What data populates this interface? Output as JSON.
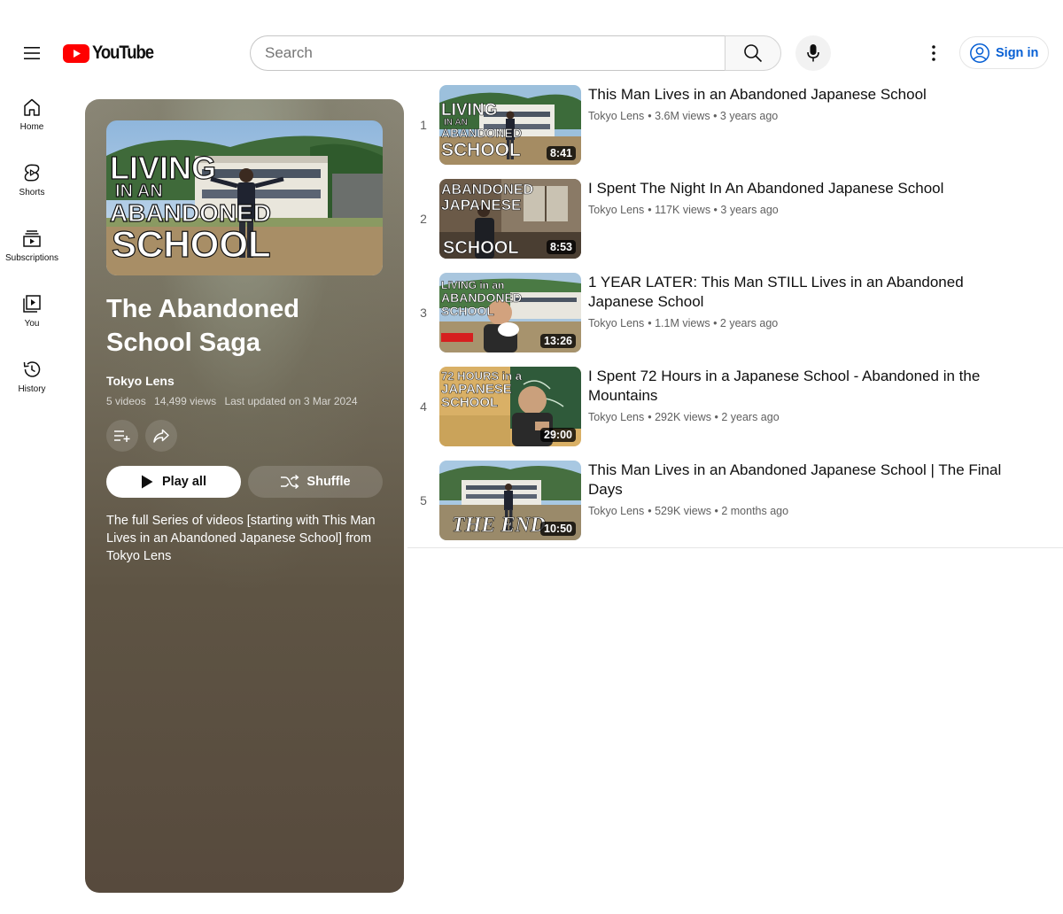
{
  "masthead": {
    "logo_text": "YouTube",
    "search_placeholder": "Search",
    "signin_label": "Sign in"
  },
  "guide": {
    "items": [
      {
        "label": "Home"
      },
      {
        "label": "Shorts"
      },
      {
        "label": "Subscriptions"
      },
      {
        "label": "You"
      },
      {
        "label": "History"
      }
    ]
  },
  "playlist": {
    "title": "The Abandoned School Saga",
    "owner": "Tokyo Lens",
    "video_count": "5 videos",
    "views": "14,499 views",
    "last_updated": "Last updated on 3 Mar 2024",
    "play_all_label": "Play all",
    "shuffle_label": "Shuffle",
    "description": "The full Series of videos [starting with This Man Lives in an Abandoned Japanese School] from Tokyo Lens",
    "thumbnail_text": [
      "LIVING",
      "IN AN",
      "ABANDONED",
      "SCHOOL"
    ]
  },
  "videos": [
    {
      "index": "1",
      "title": "This Man Lives in an Abandoned Japanese School",
      "channel": "Tokyo Lens",
      "stats": "• 3.6M views • 3 years ago",
      "duration": "8:41",
      "thumb_text": [
        "LIVING",
        "IN AN",
        "ABANDONED",
        "SCHOOL"
      ]
    },
    {
      "index": "2",
      "title": "I Spent The Night In An Abandoned Japanese School",
      "channel": "Tokyo Lens",
      "stats": "• 117K views • 3 years ago",
      "duration": "8:53",
      "thumb_text": [
        "ABANDONED",
        "JAPANESE",
        "SCHOOL"
      ]
    },
    {
      "index": "3",
      "title": "1 YEAR LATER: This Man STILL Lives in an Abandoned Japanese School",
      "channel": "Tokyo Lens",
      "stats": "• 1.1M views • 2 years ago",
      "duration": "13:26",
      "thumb_text": [
        "LIVING in an",
        "ABANDONED",
        "SCHOOL"
      ]
    },
    {
      "index": "4",
      "title": "I Spent 72 Hours in a Japanese School - Abandoned in the Mountains",
      "channel": "Tokyo Lens",
      "stats": "• 292K views • 2 years ago",
      "duration": "29:00",
      "thumb_text": [
        "72 HOURS in a",
        "JAPANESE",
        "SCHOOL"
      ]
    },
    {
      "index": "5",
      "title": "This Man Lives in an Abandoned Japanese School | The Final Days",
      "channel": "Tokyo Lens",
      "stats": "• 529K views • 2 months ago",
      "duration": "10:50",
      "thumb_text": [
        "THE END"
      ]
    }
  ],
  "colors": {
    "brand_red": "#ff0000",
    "link_blue": "#065fd4",
    "card_brown": "#5e5444"
  }
}
